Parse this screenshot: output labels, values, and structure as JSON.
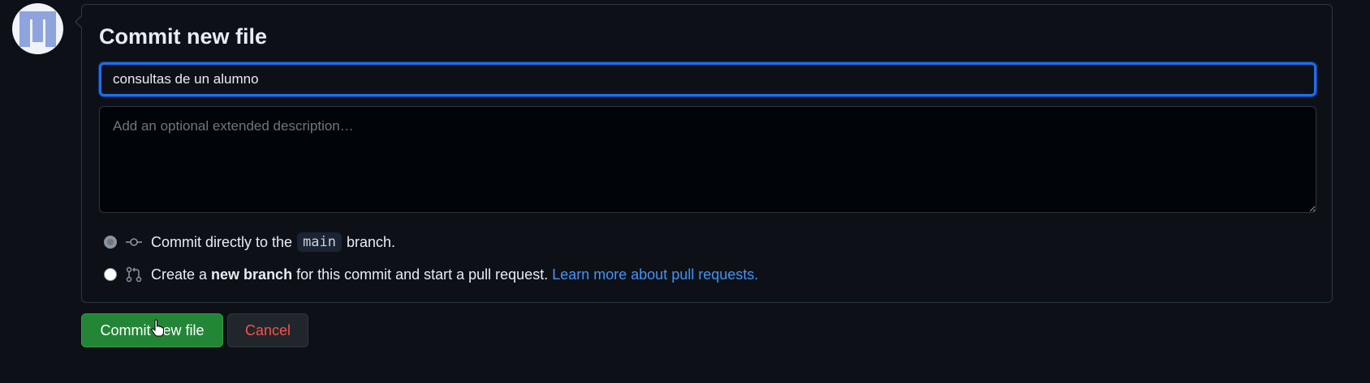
{
  "avatar": {
    "icon": "user-avatar-icon"
  },
  "panel": {
    "title": "Commit new file",
    "summary": {
      "value": "consultas de un alumno"
    },
    "description": {
      "placeholder": "Add an optional extended description…"
    },
    "options": {
      "direct": {
        "prefix": "Commit directly to the",
        "branch": "main",
        "suffix": "branch.",
        "icon": "git-commit-icon",
        "checked": true
      },
      "new_branch": {
        "prefix": "Create a",
        "bold": "new branch",
        "suffix": "for this commit and start a pull request.",
        "link": "Learn more about pull requests.",
        "icon": "git-pull-request-icon",
        "checked": false
      }
    }
  },
  "buttons": {
    "commit": "Commit new file",
    "cancel": "Cancel"
  },
  "colors": {
    "background": "#0d1117",
    "primary": "#238636",
    "danger": "#f85149",
    "link": "#4493f8",
    "focus": "#1f6feb"
  }
}
